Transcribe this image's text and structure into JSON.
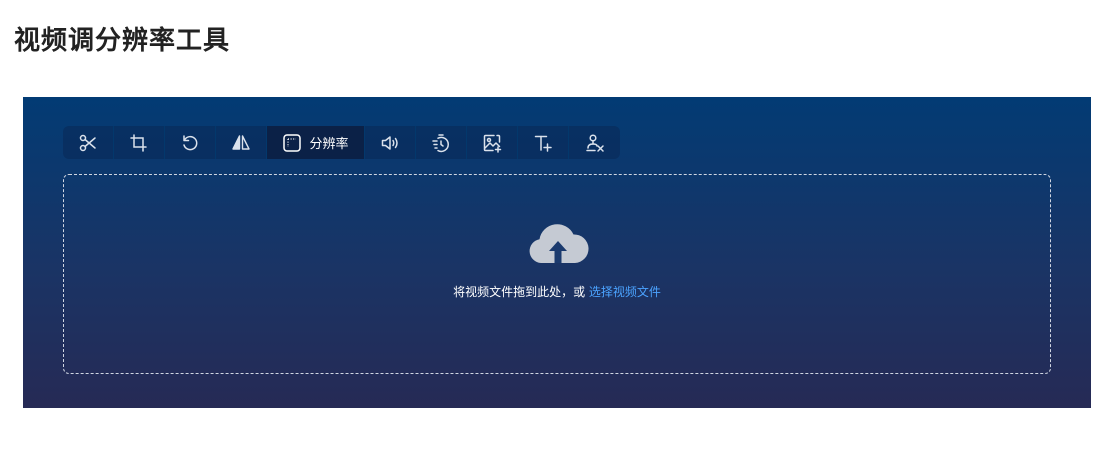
{
  "header": {
    "title": "视频调分辨率工具"
  },
  "toolbar": {
    "tools": [
      {
        "name": "scissors-icon",
        "label": ""
      },
      {
        "name": "crop-icon",
        "label": ""
      },
      {
        "name": "rotate-icon",
        "label": ""
      },
      {
        "name": "flip-icon",
        "label": ""
      },
      {
        "name": "resolution-icon",
        "label": "分辨率",
        "active": true
      },
      {
        "name": "volume-icon",
        "label": ""
      },
      {
        "name": "speed-icon",
        "label": ""
      },
      {
        "name": "image-add-icon",
        "label": ""
      },
      {
        "name": "text-add-icon",
        "label": ""
      },
      {
        "name": "watermark-remove-icon",
        "label": ""
      }
    ]
  },
  "dropzone": {
    "prompt": "将视频文件拖到此处，或 ",
    "link": "选择视频文件",
    "icon": "cloud-upload-icon"
  },
  "colors": {
    "panel_top": "#023b74",
    "panel_bottom": "#262a55",
    "link": "#4ba3ff",
    "active_tool": "#0b2147"
  }
}
